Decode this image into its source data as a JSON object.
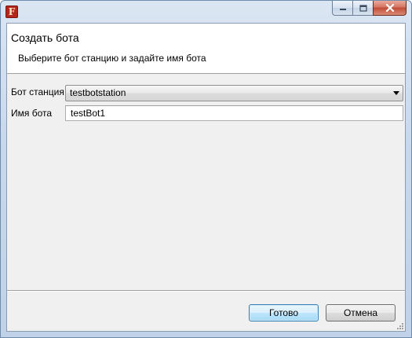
{
  "window": {
    "icon_letter": "F",
    "icons": {
      "app": "app-icon",
      "minimize": "minimize-icon",
      "maximize": "maximize-icon",
      "close": "close-icon"
    }
  },
  "header": {
    "title": "Создать бота",
    "description": "Выберите бот станцию и задайте имя бота"
  },
  "form": {
    "station_label": "Бот станция",
    "station_value": "testbotstation",
    "name_label": "Имя бота",
    "name_value": "testBot1"
  },
  "buttons": {
    "ok": "Готово",
    "cancel": "Отмена"
  },
  "colors": {
    "title_bar": "#c9d9ec",
    "close_button": "#c04a35",
    "default_button_border": "#3c7fb1"
  }
}
